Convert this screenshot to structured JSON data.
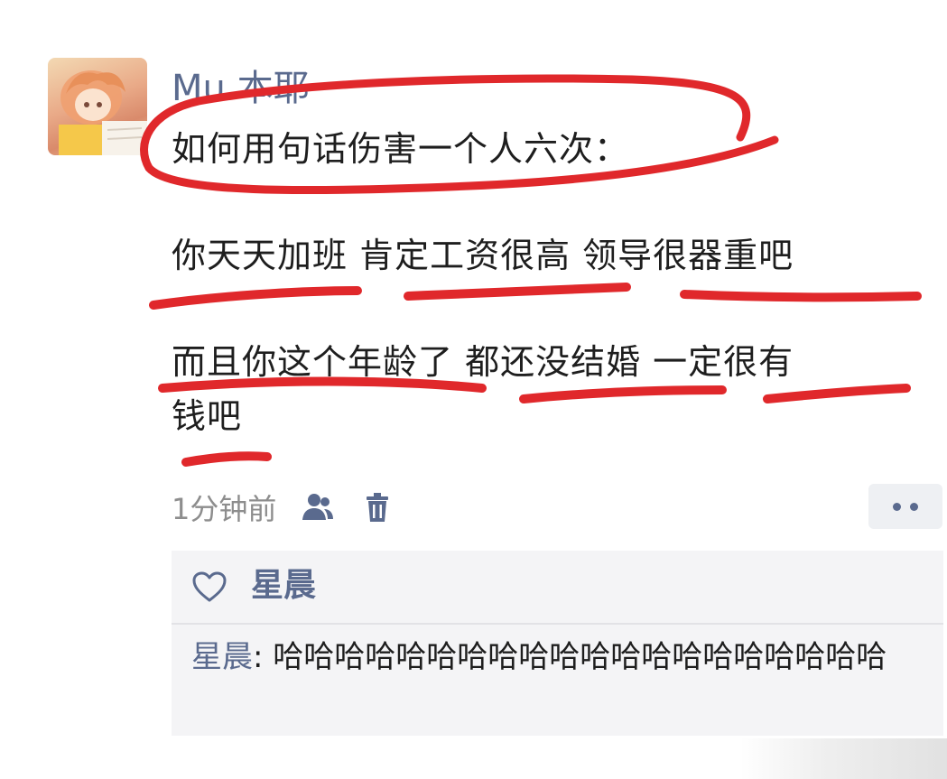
{
  "post": {
    "author": "Mu 本耶",
    "lines": [
      "如何用句话伤害一个人六次：",
      "你天天加班  肯定工资很高  领导很器重吧",
      "而且你这个年龄了  都还没结婚  一定很有",
      "钱吧"
    ],
    "time": "1分钟前",
    "icons": {
      "privacy": "people-icon",
      "delete": "trash-icon",
      "more": "more-dots-icon",
      "like": "heart-icon"
    },
    "accent_color": "#5a6a8e",
    "annotation_color": "#e0282b"
  },
  "comments": {
    "likers": "星晨",
    "items": [
      {
        "author": "星晨",
        "separator": ": ",
        "text": "哈哈哈哈哈哈哈哈哈哈哈哈哈哈哈哈哈哈哈哈"
      }
    ]
  }
}
